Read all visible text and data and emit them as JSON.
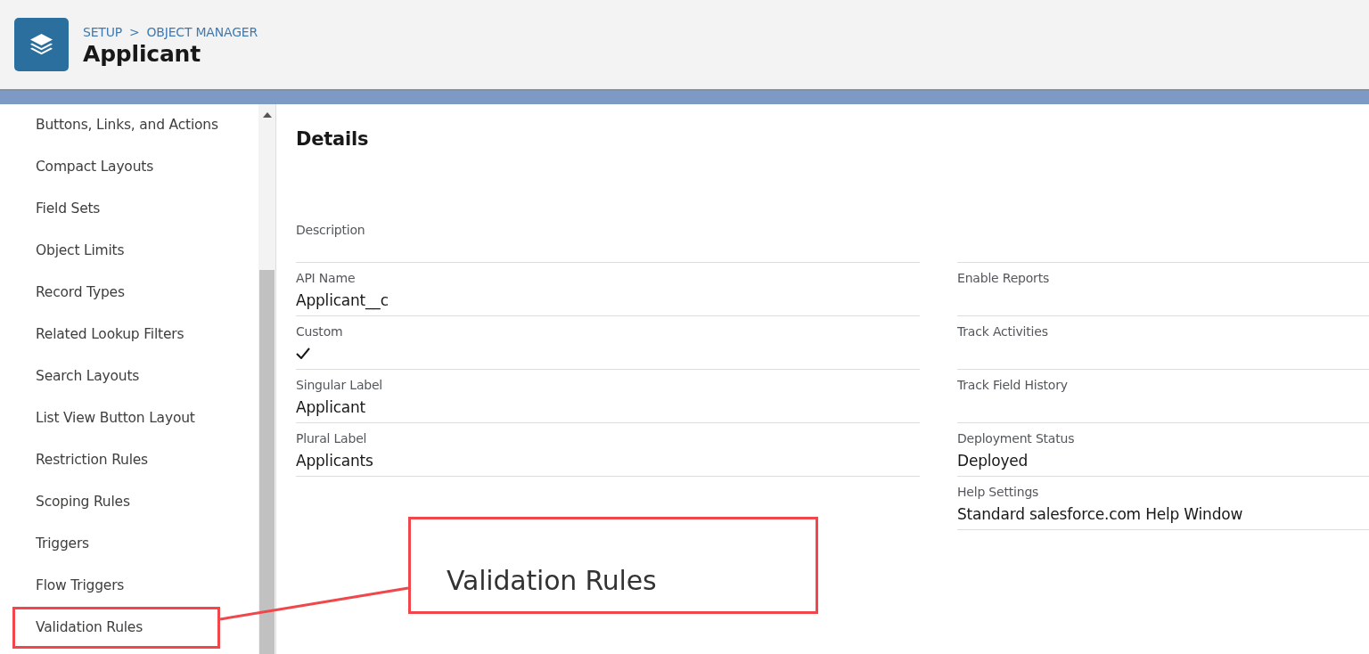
{
  "header": {
    "breadcrumb": [
      "SETUP",
      ">",
      "OBJECT MANAGER"
    ],
    "title": "Applicant"
  },
  "sidebar": {
    "items": [
      {
        "label": "Buttons, Links, and Actions",
        "highlighted": false
      },
      {
        "label": "Compact Layouts",
        "highlighted": false
      },
      {
        "label": "Field Sets",
        "highlighted": false
      },
      {
        "label": "Object Limits",
        "highlighted": false
      },
      {
        "label": "Record Types",
        "highlighted": false
      },
      {
        "label": "Related Lookup Filters",
        "highlighted": false
      },
      {
        "label": "Search Layouts",
        "highlighted": false
      },
      {
        "label": "List View Button Layout",
        "highlighted": false
      },
      {
        "label": "Restriction Rules",
        "highlighted": false
      },
      {
        "label": "Scoping Rules",
        "highlighted": false
      },
      {
        "label": "Triggers",
        "highlighted": false
      },
      {
        "label": "Flow Triggers",
        "highlighted": false
      },
      {
        "label": "Validation Rules",
        "highlighted": true
      }
    ]
  },
  "details": {
    "heading": "Details",
    "left_fields": [
      {
        "label": "Description",
        "kind": "text"
      },
      {
        "label": "API Name",
        "kind": "text",
        "value": "Applicant__c"
      },
      {
        "label": "Custom",
        "kind": "checkbox",
        "checked": true
      },
      {
        "label": "Singular Label",
        "kind": "text",
        "value": "Applicant"
      },
      {
        "label": "Plural Label",
        "kind": "text",
        "value": "Applicants"
      }
    ],
    "right_fields": [
      {
        "label": "Enable Reports",
        "kind": "checkbox",
        "checked": false
      },
      {
        "label": "Track Activities",
        "kind": "checkbox",
        "checked": false
      },
      {
        "label": "Track Field History",
        "kind": "checkbox",
        "checked": false
      },
      {
        "label": "Deployment Status",
        "kind": "text",
        "value": "Deployed"
      },
      {
        "label": "Help Settings",
        "kind": "text",
        "value": "Standard salesforce.com Help Window"
      }
    ]
  },
  "callout": {
    "text": "Validation Rules"
  }
}
